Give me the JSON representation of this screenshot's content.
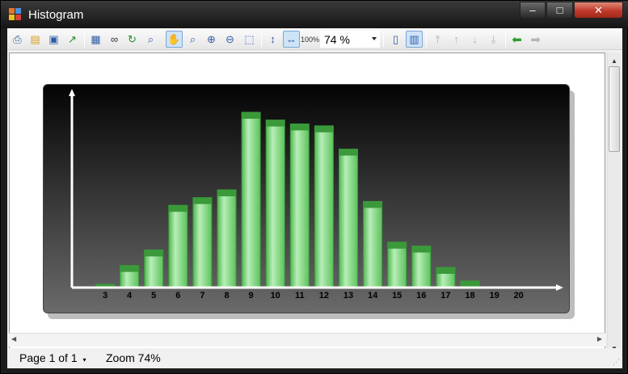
{
  "window": {
    "title": "Histogram"
  },
  "toolbar": {
    "zoom_value": "74 %"
  },
  "status": {
    "page": "Page 1 of 1",
    "zoom": "Zoom 74%"
  },
  "colors": {
    "bar": "#66cc66",
    "bar_top": "#3a9a3a",
    "chart_bg_top": "#050505",
    "chart_bg_bottom": "#6a6a6a"
  },
  "chart_data": {
    "type": "bar",
    "title": "",
    "xlabel": "",
    "ylabel": "",
    "categories": [
      "3",
      "4",
      "5",
      "6",
      "7",
      "8",
      "9",
      "10",
      "11",
      "12",
      "13",
      "14",
      "15",
      "16",
      "17",
      "18",
      "19",
      "20"
    ],
    "values": [
      1.3,
      11,
      19,
      42,
      46,
      50,
      90,
      86,
      84,
      83,
      71,
      44,
      23,
      21,
      10,
      3,
      0,
      0
    ],
    "ylim": [
      0,
      100
    ],
    "grid": false
  }
}
